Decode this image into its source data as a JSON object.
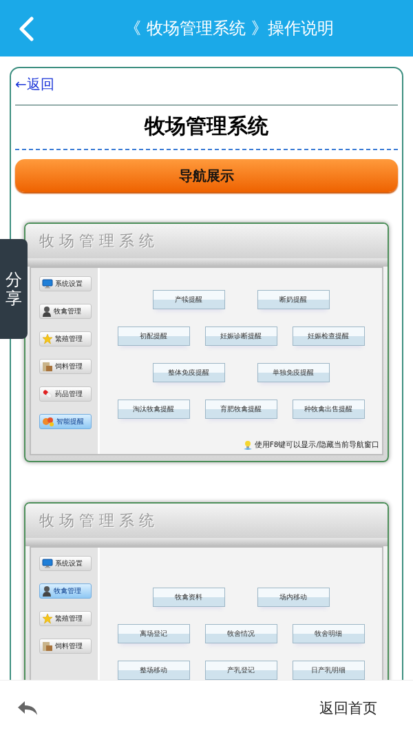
{
  "header": {
    "title": "《 牧场管理系统 》操作说明"
  },
  "share_tab": {
    "label": "分享"
  },
  "back_link": "←返回",
  "page_title": "牧场管理系统",
  "section_button": "导航展示",
  "screenshots": [
    {
      "title": "牧场管理系统",
      "sidebar": [
        {
          "label": "系统设置",
          "selected": false
        },
        {
          "label": "牧禽管理",
          "selected": false
        },
        {
          "label": "繁殖管理",
          "selected": false
        },
        {
          "label": "饲料管理",
          "selected": false
        },
        {
          "label": "药品管理",
          "selected": false
        },
        {
          "label": "智能提醒",
          "selected": true
        }
      ],
      "button_rows": [
        [
          "产犊提醒",
          "断奶提醒"
        ],
        [
          "初配提醒",
          "妊娠诊断提醒",
          "妊娠检查提醒"
        ],
        [
          "整体免疫提醒",
          "单独免疫提醒"
        ],
        [
          "淘汰牧禽提醒",
          "育肥牧禽提醒",
          "种牧禽出售提醒"
        ]
      ],
      "hint": "使用F8键可以显示/隐藏当前导航窗口"
    },
    {
      "title": "牧场管理系统",
      "sidebar": [
        {
          "label": "系统设置",
          "selected": false
        },
        {
          "label": "牧禽管理",
          "selected": true
        },
        {
          "label": "繁殖管理",
          "selected": false
        },
        {
          "label": "饲料管理",
          "selected": false
        }
      ],
      "button_rows": [
        [
          "牧禽资料",
          "场内移动"
        ],
        [
          "离场登记",
          "牧舍情况",
          "牧舍明细"
        ],
        [
          "整场移动",
          "产乳登记",
          "日产乳明细"
        ]
      ]
    }
  ],
  "bottom_bar": {
    "home_link": "返回首页"
  }
}
